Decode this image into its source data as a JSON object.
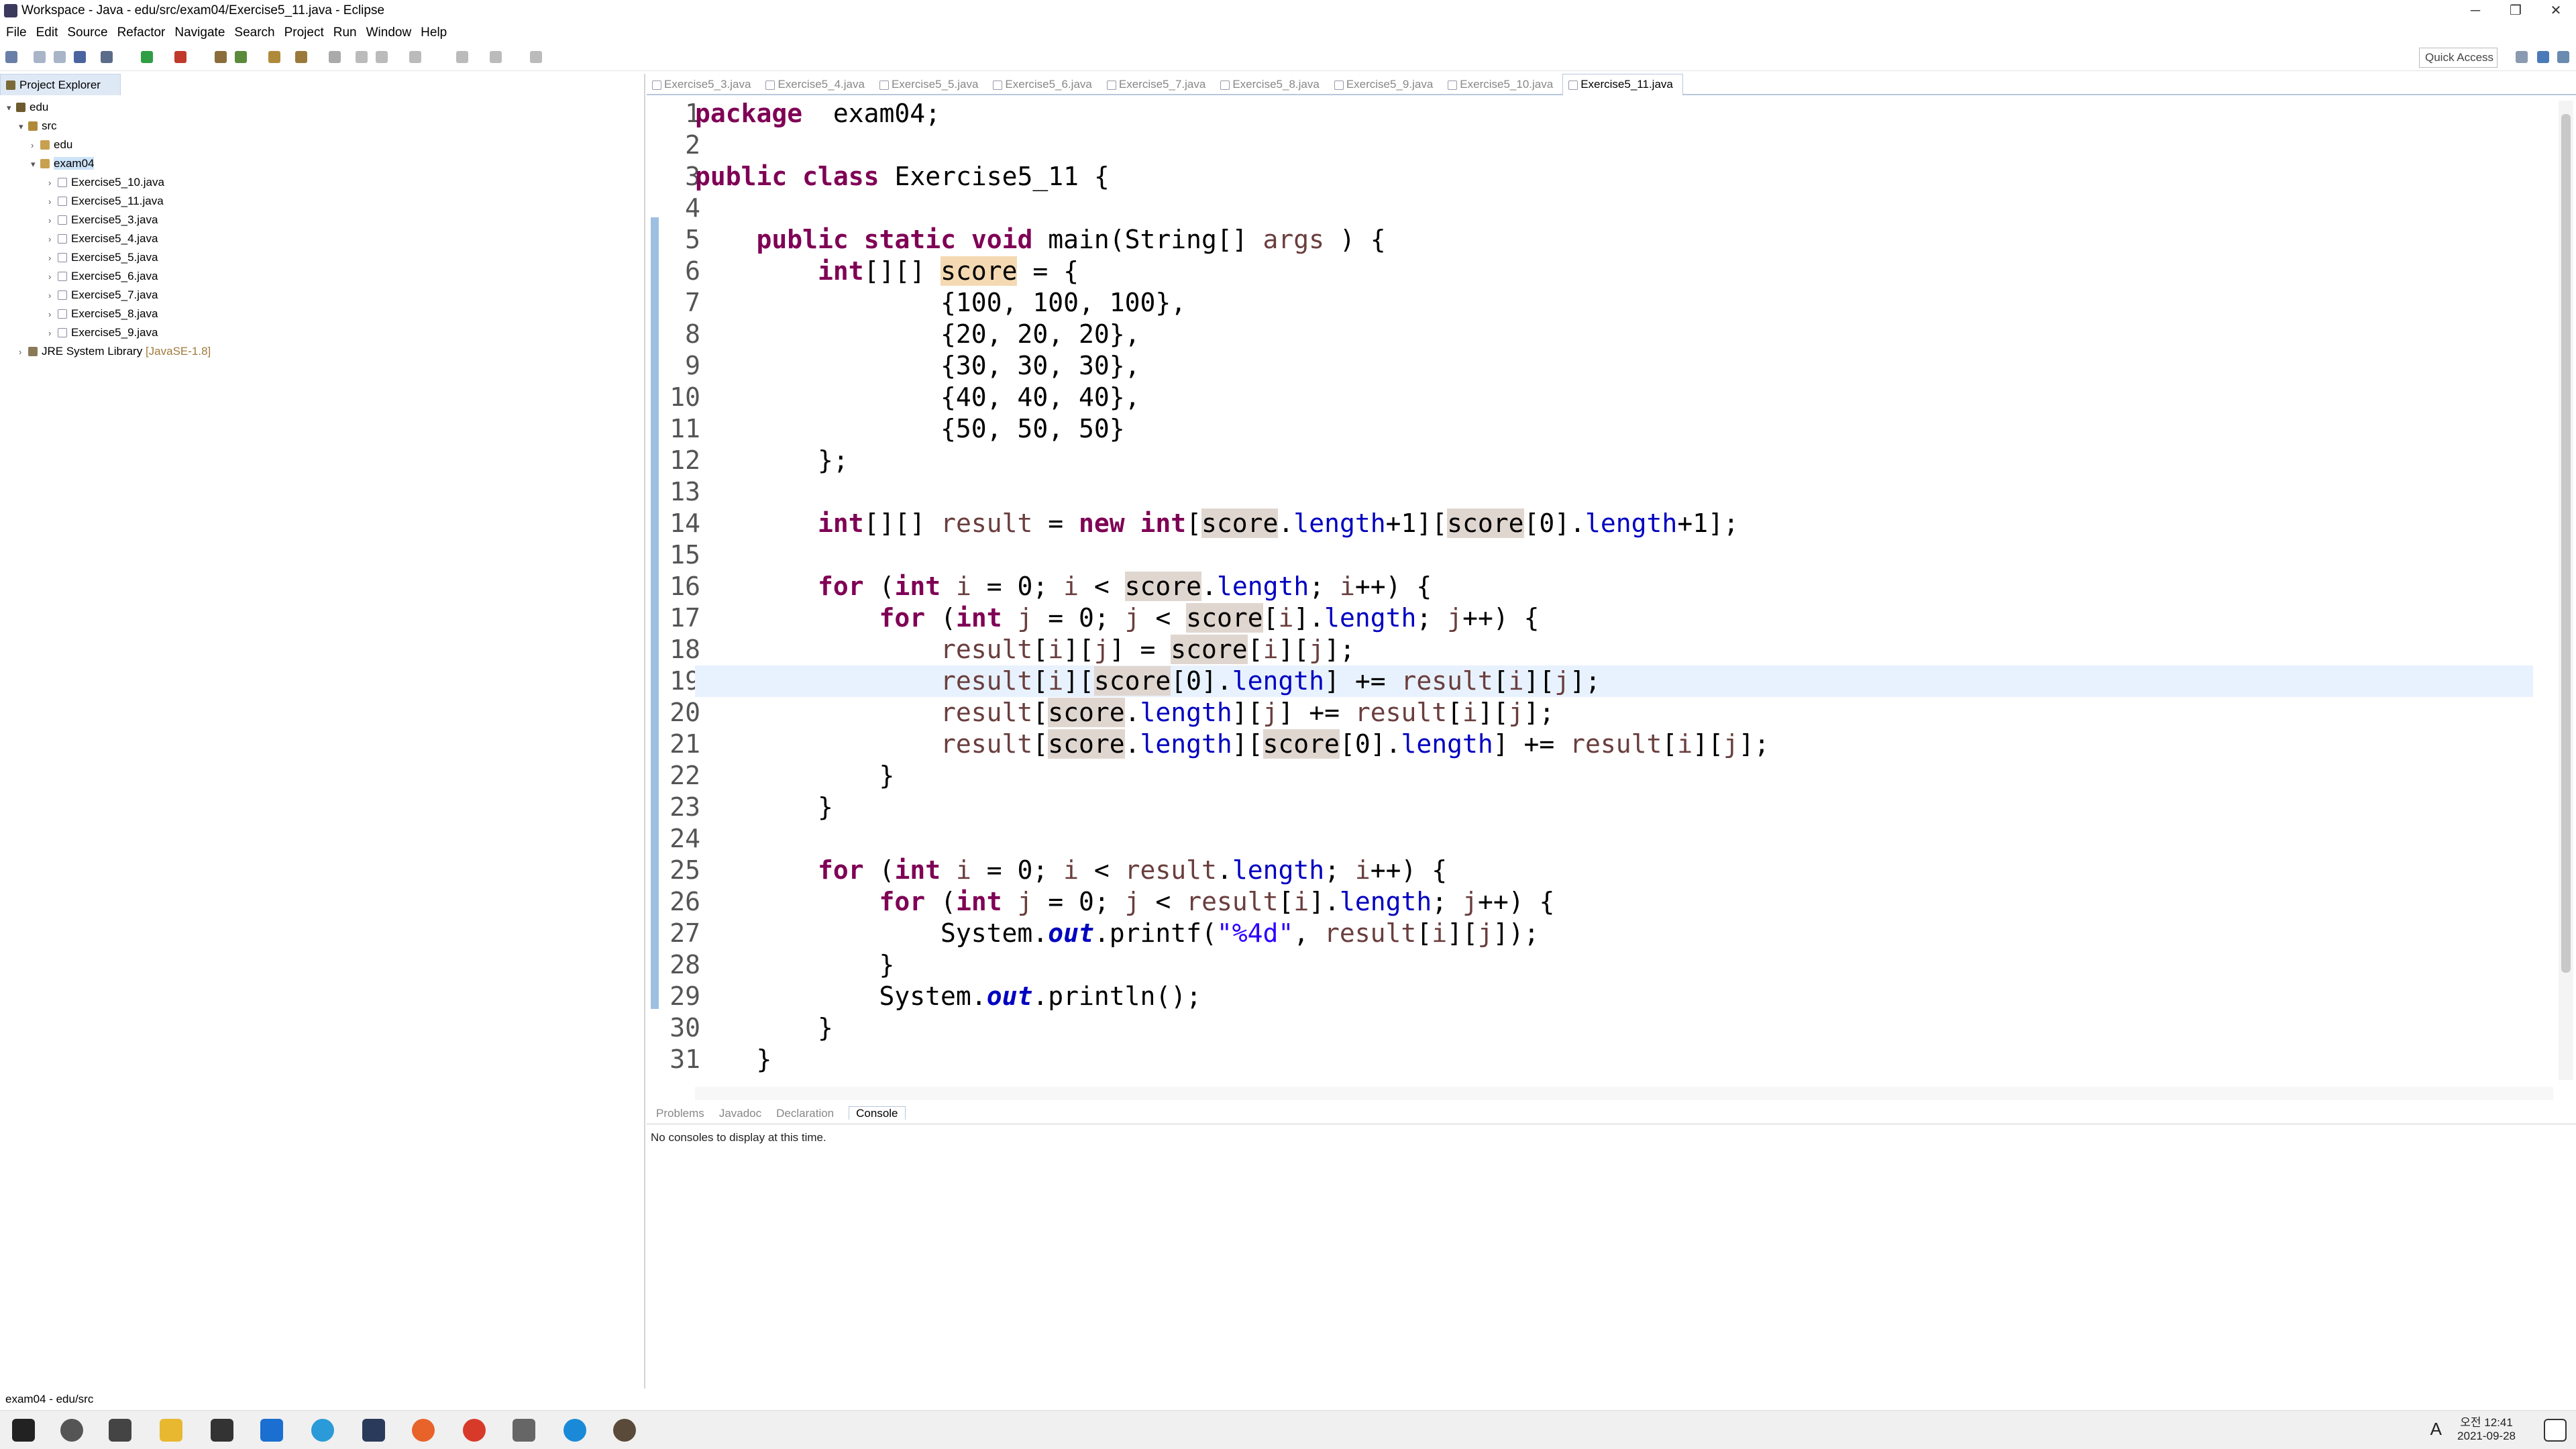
{
  "window": {
    "title": "Workspace - Java - edu/src/exam04/Exercise5_11.java - Eclipse"
  },
  "menu": [
    "File",
    "Edit",
    "Source",
    "Refactor",
    "Navigate",
    "Search",
    "Project",
    "Run",
    "Window",
    "Help"
  ],
  "toolbar": {
    "quick_access": "Quick Access"
  },
  "explorer": {
    "tab_label": "Project Explorer",
    "tree": [
      {
        "label": "edu",
        "level": 0
      },
      {
        "label": "src",
        "level": 1
      },
      {
        "label": "edu",
        "level": 2
      },
      {
        "label": "exam04",
        "level": 2,
        "selected": true
      },
      {
        "label": "Exercise5_10.java",
        "level": 3
      },
      {
        "label": "Exercise5_11.java",
        "level": 3
      },
      {
        "label": "Exercise5_3.java",
        "level": 3
      },
      {
        "label": "Exercise5_4.java",
        "level": 3
      },
      {
        "label": "Exercise5_5.java",
        "level": 3
      },
      {
        "label": "Exercise5_6.java",
        "level": 3
      },
      {
        "label": "Exercise5_7.java",
        "level": 3
      },
      {
        "label": "Exercise5_8.java",
        "level": 3
      },
      {
        "label": "Exercise5_9.java",
        "level": 3
      }
    ],
    "jre": {
      "label": "JRE System Library",
      "version": "[JavaSE-1.8]"
    }
  },
  "editor": {
    "tabs": [
      "Exercise5_3.java",
      "Exercise5_4.java",
      "Exercise5_5.java",
      "Exercise5_6.java",
      "Exercise5_7.java",
      "Exercise5_8.java",
      "Exercise5_9.java",
      "Exercise5_10.java",
      "Exercise5_11.java"
    ],
    "active_tab": "Exercise5_11.java",
    "current_line": 19,
    "line_numbers": [
      "1",
      "2",
      "3",
      "4",
      "5",
      "6",
      "7",
      "8",
      "9",
      "10",
      "11",
      "12",
      "13",
      "14",
      "15",
      "16",
      "17",
      "18",
      "19",
      "20",
      "21",
      "22",
      "23",
      "24",
      "25",
      "26",
      "27",
      "28",
      "29",
      "30",
      "31"
    ],
    "lines": [
      [
        [
          "kw",
          "package"
        ],
        [
          "",
          "  exam04;"
        ]
      ],
      [],
      [
        [
          "kw",
          "public"
        ],
        [
          "",
          " "
        ],
        [
          "kw",
          "class"
        ],
        [
          "",
          " Exercise5_11 {"
        ]
      ],
      [],
      [
        [
          "",
          "    "
        ],
        [
          "kw",
          "public"
        ],
        [
          "",
          " "
        ],
        [
          "kw",
          "static"
        ],
        [
          "",
          " "
        ],
        [
          "kw",
          "void"
        ],
        [
          "",
          " main(String[] "
        ],
        [
          "var",
          "args"
        ],
        [
          "",
          " ) {"
        ]
      ],
      [
        [
          "",
          "        "
        ],
        [
          "kw",
          "int"
        ],
        [
          "",
          "[][] "
        ],
        [
          "hlw",
          "score"
        ],
        [
          "",
          " = {"
        ]
      ],
      [
        [
          "",
          "                {100, 100, 100},"
        ]
      ],
      [
        [
          "",
          "                {20, 20, 20},"
        ]
      ],
      [
        [
          "",
          "                {30, 30, 30},"
        ]
      ],
      [
        [
          "",
          "                {40, 40, 40},"
        ]
      ],
      [
        [
          "",
          "                {50, 50, 50}"
        ]
      ],
      [
        [
          "",
          "        };"
        ]
      ],
      [],
      [
        [
          "",
          "        "
        ],
        [
          "kw",
          "int"
        ],
        [
          "",
          "[][] "
        ],
        [
          "var",
          "result"
        ],
        [
          "",
          " = "
        ],
        [
          "kw",
          "new"
        ],
        [
          "",
          " "
        ],
        [
          "kw",
          "int"
        ],
        [
          "",
          "["
        ],
        [
          "hl",
          "score"
        ],
        [
          "",
          "."
        ],
        [
          "fld",
          "length"
        ],
        [
          "",
          "+1]["
        ],
        [
          "hl",
          "score"
        ],
        [
          "",
          "[0]."
        ],
        [
          "fld",
          "length"
        ],
        [
          "",
          "+1];"
        ]
      ],
      [],
      [
        [
          "",
          "        "
        ],
        [
          "kw",
          "for"
        ],
        [
          "",
          " ("
        ],
        [
          "kw",
          "int"
        ],
        [
          "",
          " "
        ],
        [
          "var",
          "i"
        ],
        [
          "",
          " = 0; "
        ],
        [
          "var",
          "i"
        ],
        [
          "",
          " < "
        ],
        [
          "hl",
          "score"
        ],
        [
          "",
          "."
        ],
        [
          "fld",
          "length"
        ],
        [
          "",
          "; "
        ],
        [
          "var",
          "i"
        ],
        [
          "",
          "++) {"
        ]
      ],
      [
        [
          "",
          "            "
        ],
        [
          "kw",
          "for"
        ],
        [
          "",
          " ("
        ],
        [
          "kw",
          "int"
        ],
        [
          "",
          " "
        ],
        [
          "var",
          "j"
        ],
        [
          "",
          " = 0; "
        ],
        [
          "var",
          "j"
        ],
        [
          "",
          " < "
        ],
        [
          "hl",
          "score"
        ],
        [
          "",
          "["
        ],
        [
          "var",
          "i"
        ],
        [
          "",
          "]."
        ],
        [
          "fld",
          "length"
        ],
        [
          "",
          "; "
        ],
        [
          "var",
          "j"
        ],
        [
          "",
          "++) {"
        ]
      ],
      [
        [
          "",
          "                "
        ],
        [
          "var",
          "result"
        ],
        [
          "",
          "["
        ],
        [
          "var",
          "i"
        ],
        [
          "",
          "]["
        ],
        [
          "var",
          "j"
        ],
        [
          "",
          "] = "
        ],
        [
          "hl",
          "score"
        ],
        [
          "",
          "["
        ],
        [
          "var",
          "i"
        ],
        [
          "",
          "]["
        ],
        [
          "var",
          "j"
        ],
        [
          "",
          "];"
        ]
      ],
      [
        [
          "",
          "                "
        ],
        [
          "var",
          "result"
        ],
        [
          "",
          "["
        ],
        [
          "var",
          "i"
        ],
        [
          "",
          "]["
        ],
        [
          "hl",
          "score"
        ],
        [
          "",
          "[0]."
        ],
        [
          "fld",
          "length"
        ],
        [
          "",
          "] += "
        ],
        [
          "var",
          "result"
        ],
        [
          "",
          "["
        ],
        [
          "var",
          "i"
        ],
        [
          "",
          "]["
        ],
        [
          "var",
          "j"
        ],
        [
          "",
          "];"
        ]
      ],
      [
        [
          "",
          "                "
        ],
        [
          "var",
          "result"
        ],
        [
          "",
          "["
        ],
        [
          "hl",
          "score"
        ],
        [
          "",
          "."
        ],
        [
          "fld",
          "length"
        ],
        [
          "",
          "]["
        ],
        [
          "var",
          "j"
        ],
        [
          "",
          "] += "
        ],
        [
          "var",
          "result"
        ],
        [
          "",
          "["
        ],
        [
          "var",
          "i"
        ],
        [
          "",
          "]["
        ],
        [
          "var",
          "j"
        ],
        [
          "",
          "];"
        ]
      ],
      [
        [
          "",
          "                "
        ],
        [
          "var",
          "result"
        ],
        [
          "",
          "["
        ],
        [
          "hl",
          "score"
        ],
        [
          "",
          "."
        ],
        [
          "fld",
          "length"
        ],
        [
          "",
          "]["
        ],
        [
          "hl",
          "score"
        ],
        [
          "",
          "[0]."
        ],
        [
          "fld",
          "length"
        ],
        [
          "",
          "] += "
        ],
        [
          "var",
          "result"
        ],
        [
          "",
          "["
        ],
        [
          "var",
          "i"
        ],
        [
          "",
          "]["
        ],
        [
          "var",
          "j"
        ],
        [
          "",
          "];"
        ]
      ],
      [
        [
          "",
          "            }"
        ]
      ],
      [
        [
          "",
          "        }"
        ]
      ],
      [],
      [
        [
          "",
          "        "
        ],
        [
          "kw",
          "for"
        ],
        [
          "",
          " ("
        ],
        [
          "kw",
          "int"
        ],
        [
          "",
          " "
        ],
        [
          "var",
          "i"
        ],
        [
          "",
          " = 0; "
        ],
        [
          "var",
          "i"
        ],
        [
          "",
          " < "
        ],
        [
          "var",
          "result"
        ],
        [
          "",
          "."
        ],
        [
          "fld",
          "length"
        ],
        [
          "",
          "; "
        ],
        [
          "var",
          "i"
        ],
        [
          "",
          "++) {"
        ]
      ],
      [
        [
          "",
          "            "
        ],
        [
          "kw",
          "for"
        ],
        [
          "",
          " ("
        ],
        [
          "kw",
          "int"
        ],
        [
          "",
          " "
        ],
        [
          "var",
          "j"
        ],
        [
          "",
          " = 0; "
        ],
        [
          "var",
          "j"
        ],
        [
          "",
          " < "
        ],
        [
          "var",
          "result"
        ],
        [
          "",
          "["
        ],
        [
          "var",
          "i"
        ],
        [
          "",
          "]."
        ],
        [
          "fld",
          "length"
        ],
        [
          "",
          "; "
        ],
        [
          "var",
          "j"
        ],
        [
          "",
          "++) {"
        ]
      ],
      [
        [
          "",
          "                System."
        ],
        [
          "it",
          "out"
        ],
        [
          "",
          ".printf("
        ],
        [
          "str",
          "\"%4d\""
        ],
        [
          "",
          ", "
        ],
        [
          "var",
          "result"
        ],
        [
          "",
          "["
        ],
        [
          "var",
          "i"
        ],
        [
          "",
          "]["
        ],
        [
          "var",
          "j"
        ],
        [
          "",
          "]);"
        ]
      ],
      [
        [
          "",
          "            }"
        ]
      ],
      [
        [
          "",
          "            System."
        ],
        [
          "it",
          "out"
        ],
        [
          "",
          ".println();"
        ]
      ],
      [
        [
          "",
          "        }"
        ]
      ],
      [
        [
          "",
          "    }"
        ]
      ]
    ]
  },
  "console": {
    "tabs": [
      "Problems",
      "Javadoc",
      "Declaration",
      "Console"
    ],
    "active_tab": "Console",
    "message": "No consoles to display at this time."
  },
  "status": {
    "text": "exam04 - edu/src"
  },
  "taskbar": {
    "time": "오전 12:41",
    "date": "2021-09-28",
    "ime": "A"
  },
  "colors": {
    "keyword": "#7f0055",
    "field": "#0000c0",
    "string": "#2a00ff",
    "variable": "#6a3e3e",
    "occurrence": "#e0d6d0",
    "current_line": "#e8f2fe"
  }
}
